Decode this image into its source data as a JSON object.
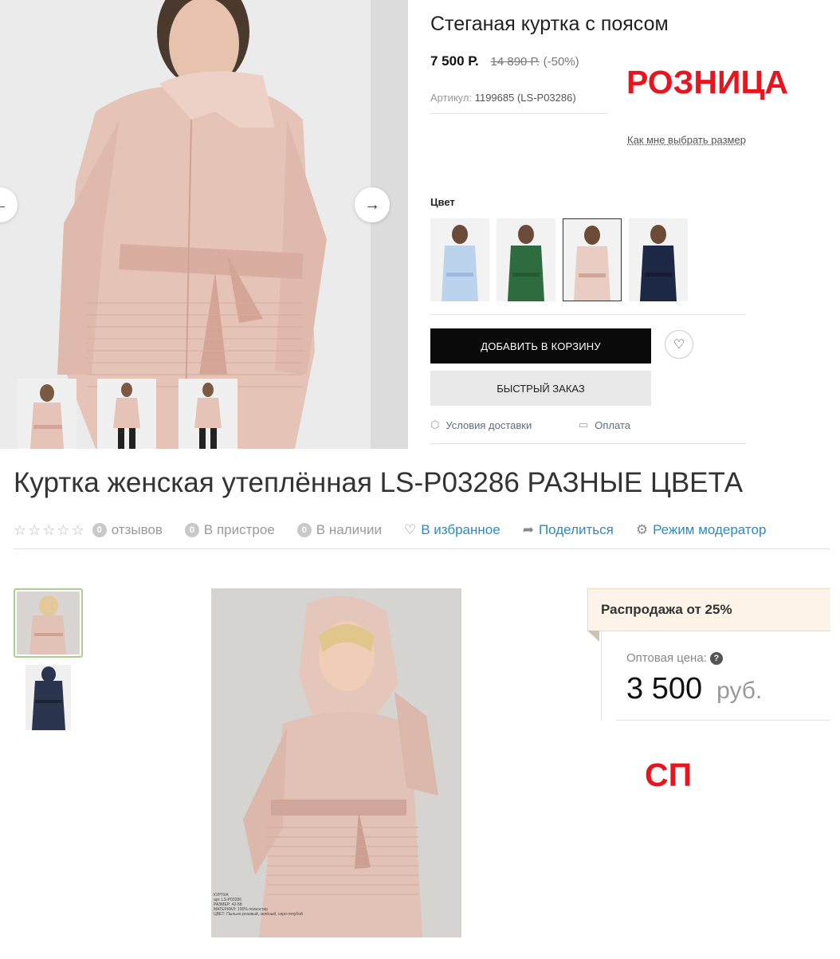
{
  "retail": {
    "title": "Стеганая куртка с поясом",
    "price_current": "7 500 Р.",
    "price_old": "14 890 Р.",
    "discount": "(-50%)",
    "sku_label": "Артикул:",
    "sku_value": "1199685 (LS-P03286)",
    "stamp": "РОЗНИЦА",
    "size_link": "Как мне выбрать размер",
    "color_label": "Цвет",
    "swatches": [
      {
        "color": "#bcd3ee",
        "name": "light-blue"
      },
      {
        "color": "#2e6b3e",
        "name": "green"
      },
      {
        "color": "#e9cdc3",
        "name": "pink",
        "selected": true
      },
      {
        "color": "#1d2844",
        "name": "navy"
      }
    ],
    "add_to_cart": "ДОБАВИТЬ В КОРЗИНУ",
    "quick_order": "БЫСТРЫЙ ЗАКАЗ",
    "delivery_link": "Условия доставки",
    "payment_link": "Оплата",
    "icons": {
      "prev": "arrow-left-icon",
      "next": "arrow-right-icon",
      "fav": "heart-icon",
      "delivery": "box-icon",
      "payment": "wallet-icon"
    },
    "jacket_color": "#e8c8bd"
  },
  "wholesale": {
    "title": "Куртка женская утеплённая LS-P03286 РАЗНЫЕ ЦВЕТА",
    "stars": "☆☆☆☆☆",
    "reviews_count": "0",
    "reviews_label": "отзывов",
    "pending_count": "0",
    "pending_label": "В пристрое",
    "stock_count": "0",
    "stock_label": "В наличии",
    "favorites": "В избранное",
    "share": "Поделиться",
    "moderator": "Режим модератор",
    "sale_banner": "Распродажа от 25%",
    "wholesale_label": "Оптовая цена:",
    "price": "3 500",
    "currency": "руб.",
    "stamp": "СП",
    "caption": {
      "line1": "КУРТКА",
      "line2": "арт. LS-P03286",
      "line3": "РАЗМЕР: 42-58",
      "line4": "МАТЕРИАЛ: 100% полиэстер",
      "line5": "ЦВЕТ: Пыльно-розовый, зелёный, серо-голубой"
    }
  }
}
